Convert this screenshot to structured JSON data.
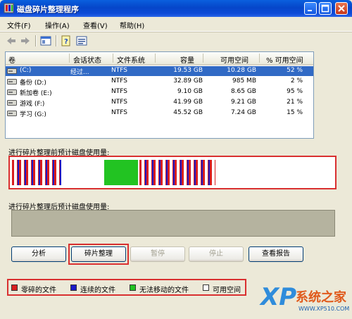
{
  "window": {
    "title": "磁盘碎片整理程序"
  },
  "menu": [
    {
      "label": "文件(F)"
    },
    {
      "label": "操作(A)"
    },
    {
      "label": "查看(V)"
    },
    {
      "label": "帮助(H)"
    }
  ],
  "table": {
    "headers": [
      "卷",
      "会话状态",
      "文件系统",
      "容量",
      "可用空间",
      "% 可用空间"
    ],
    "rows": [
      {
        "volume": "(C:)",
        "status": "经过...",
        "fs": "NTFS",
        "capacity": "19.53 GB",
        "free": "10.28 GB",
        "pct": "52 %",
        "selected": true
      },
      {
        "volume": "备份 (D:)",
        "status": "",
        "fs": "NTFS",
        "capacity": "32.89 GB",
        "free": "985 MB",
        "pct": "2 %",
        "selected": false
      },
      {
        "volume": "新加卷 (E:)",
        "status": "",
        "fs": "NTFS",
        "capacity": "9.10 GB",
        "free": "8.65 GB",
        "pct": "95 %",
        "selected": false
      },
      {
        "volume": "游戏 (F:)",
        "status": "",
        "fs": "NTFS",
        "capacity": "41.99 GB",
        "free": "9.21 GB",
        "pct": "21 %",
        "selected": false
      },
      {
        "volume": "学习 (G:)",
        "status": "",
        "fs": "NTFS",
        "capacity": "45.52 GB",
        "free": "7.24 GB",
        "pct": "15 %",
        "selected": false
      }
    ]
  },
  "before_label": "进行碎片整理前预计磁盘使用量:",
  "after_label": "进行碎片整理后预计磁盘使用量:",
  "buttons": {
    "analyze": "分析",
    "defrag": "碎片整理",
    "pause": "暂停",
    "stop": "停止",
    "report": "查看报告"
  },
  "legend": [
    {
      "label": "零碎的文件",
      "color": "#D81E1E"
    },
    {
      "label": "连续的文件",
      "color": "#1A1AC8"
    },
    {
      "label": "无法移动的文件",
      "color": "#22C322"
    },
    {
      "label": "可用空间",
      "color": "#FFFFFF"
    }
  ],
  "brand": {
    "mark": "XP",
    "name": "系统之家",
    "url": "WWW.XP510.COM"
  }
}
